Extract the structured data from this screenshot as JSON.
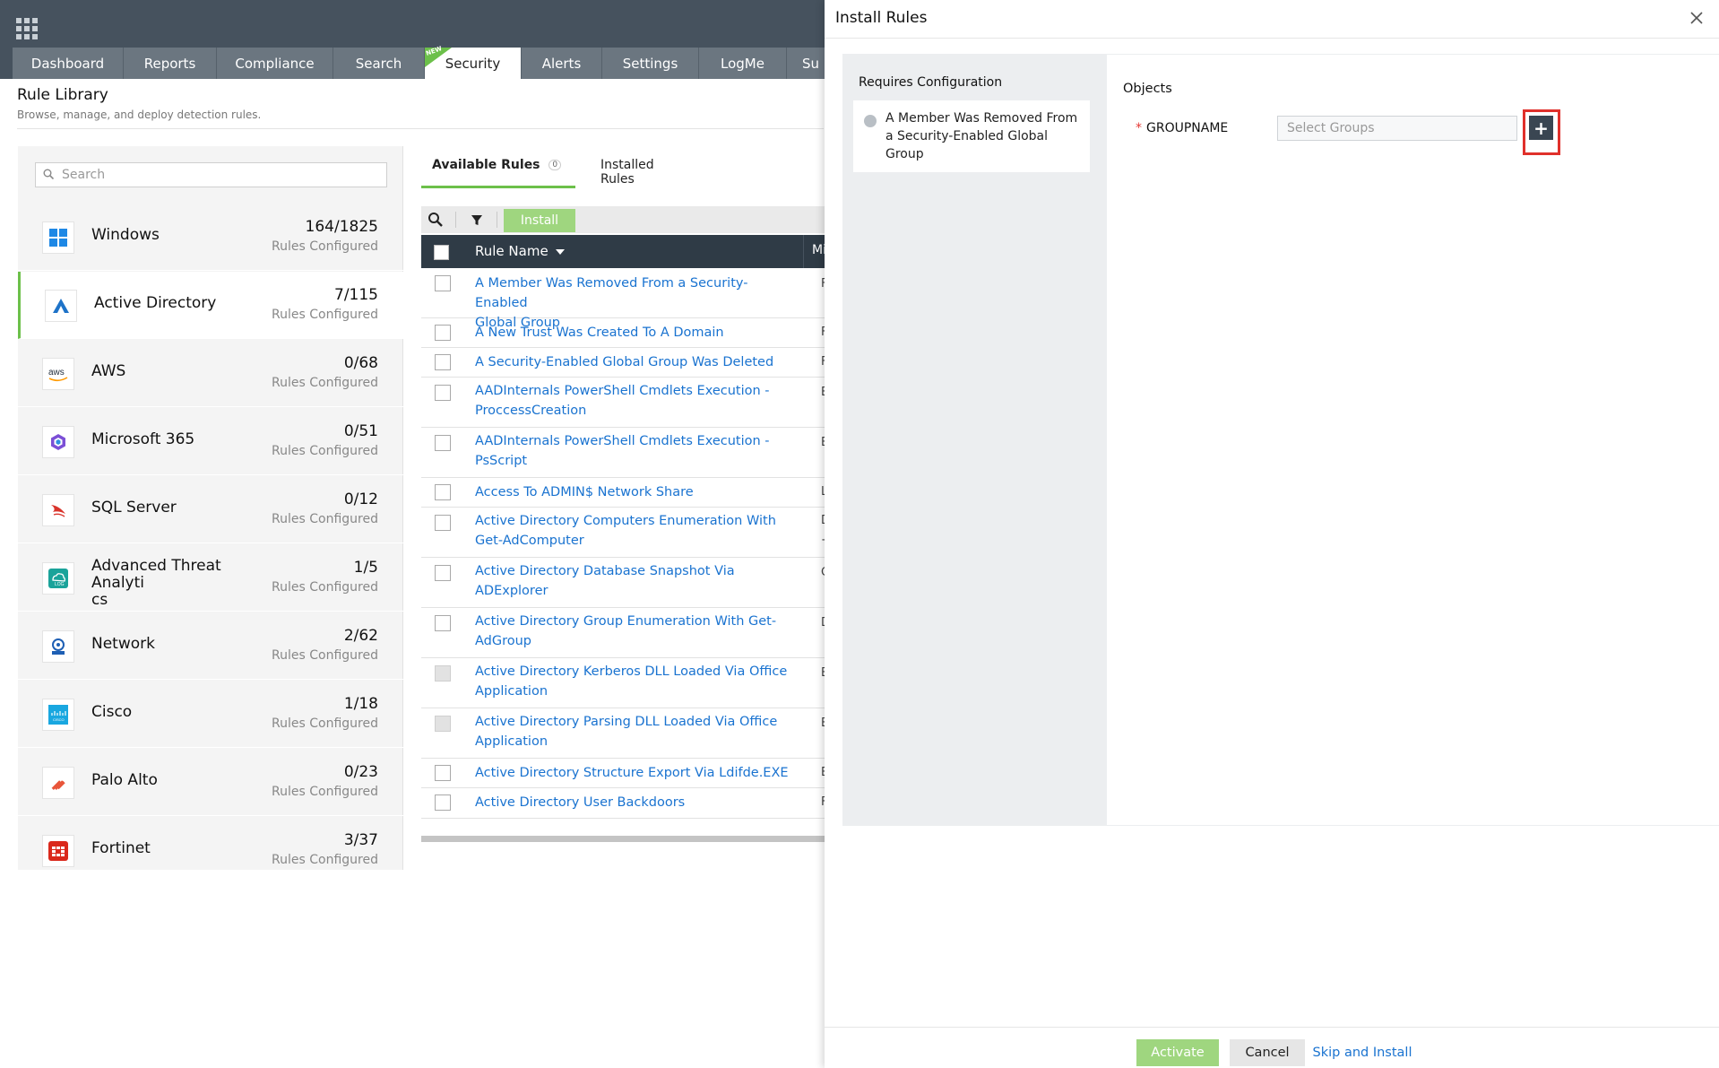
{
  "nav": {
    "tabs": [
      {
        "label": "Dashboard"
      },
      {
        "label": "Reports"
      },
      {
        "label": "Compliance"
      },
      {
        "label": "Search"
      },
      {
        "label": "Security",
        "badge": "NEW"
      },
      {
        "label": "Alerts"
      },
      {
        "label": "Settings"
      },
      {
        "label": "LogMe"
      },
      {
        "label": "Su"
      }
    ]
  },
  "page": {
    "title": "Rule Library",
    "subtitle": "Browse, manage, and deploy detection rules."
  },
  "categories": {
    "search_placeholder": "Search",
    "items": [
      {
        "name": "Windows",
        "count": "164/1825",
        "sub": "Rules Configured",
        "icon": "windows-icon"
      },
      {
        "name": "Active Directory",
        "count": "7/115",
        "sub": "Rules Configured",
        "icon": "active-directory-icon"
      },
      {
        "name": "AWS",
        "count": "0/68",
        "sub": "Rules Configured",
        "icon": "aws-icon"
      },
      {
        "name": "Microsoft 365",
        "count": "0/51",
        "sub": "Rules Configured",
        "icon": "microsoft-365-icon"
      },
      {
        "name": "SQL Server",
        "count": "0/12",
        "sub": "Rules Configured",
        "icon": "sql-server-icon"
      },
      {
        "name": "Advanced Threat Analytics",
        "name_line1": "Advanced Threat Analyti",
        "name_line2": "cs",
        "count": "1/5",
        "sub": "Rules Configured",
        "icon": "ata-icon"
      },
      {
        "name": "Network",
        "count": "2/62",
        "sub": "Rules Configured",
        "icon": "network-icon"
      },
      {
        "name": "Cisco",
        "count": "1/18",
        "sub": "Rules Configured",
        "icon": "cisco-icon"
      },
      {
        "name": "Palo Alto",
        "count": "0/23",
        "sub": "Rules Configured",
        "icon": "palo-alto-icon"
      },
      {
        "name": "Fortinet",
        "count": "3/37",
        "sub": "Rules Configured",
        "icon": "fortinet-icon"
      }
    ]
  },
  "rules": {
    "tabs": {
      "available": "Available Rules",
      "available_count": "0",
      "installed": "Installed Rules"
    },
    "install_label": "Install",
    "col_rule_name": "Rule Name",
    "col_second": "Mi",
    "rows": [
      {
        "name": "A Member Was Removed From a Security-Enabled Global Group",
        "l1": "A Member Was Removed From a Security-Enabled",
        "l2": "Global Group",
        "edge": "F"
      },
      {
        "name": "A New Trust Was Created To A Domain",
        "l1": "A New Trust Was Created To A Domain",
        "l2": "",
        "edge": "F"
      },
      {
        "name": "A Security-Enabled Global Group Was Deleted",
        "l1": "A Security-Enabled Global Group Was Deleted",
        "l2": "",
        "edge": "F"
      },
      {
        "name": "AADInternals PowerShell Cmdlets Execution - ProccessCreation",
        "l1": "AADInternals PowerShell Cmdlets Execution -",
        "l2": "ProccessCreation",
        "edge": "E"
      },
      {
        "name": "AADInternals PowerShell Cmdlets Execution - PsScript",
        "l1": "AADInternals PowerShell Cmdlets Execution -",
        "l2": "PsScript",
        "edge": "E"
      },
      {
        "name": "Access To ADMIN$ Network Share",
        "l1": "Access To ADMIN$ Network Share",
        "l2": "",
        "edge": "L"
      },
      {
        "name": "Active Directory Computers Enumeration With Get-AdComputer",
        "l1": "Active Directory Computers Enumeration With",
        "l2": "Get-AdComputer",
        "edge": "D",
        "edge2": "+"
      },
      {
        "name": "Active Directory Database Snapshot Via ADExplorer",
        "l1": "Active Directory Database Snapshot Via",
        "l2": "ADExplorer",
        "edge": "C"
      },
      {
        "name": "Active Directory Group Enumeration With Get-AdGroup",
        "l1": "Active Directory Group Enumeration With Get-",
        "l2": "AdGroup",
        "edge": "D"
      },
      {
        "name": "Active Directory Kerberos DLL Loaded Via Office Application",
        "l1": "Active Directory Kerberos DLL Loaded Via Office",
        "l2": "Application",
        "edge": "E",
        "disabled": true
      },
      {
        "name": "Active Directory Parsing DLL Loaded Via Office Application",
        "l1": "Active Directory Parsing DLL Loaded Via Office",
        "l2": "Application",
        "edge": "E",
        "disabled": true
      },
      {
        "name": "Active Directory Structure Export Via Ldifde.EXE",
        "l1": "Active Directory Structure Export Via Ldifde.EXE",
        "l2": "",
        "edge": "E"
      },
      {
        "name": "Active Directory User Backdoors",
        "l1": "Active Directory User Backdoors",
        "l2": "",
        "edge": "F"
      }
    ]
  },
  "dialog": {
    "title": "Install Rules",
    "requires_heading": "Requires Configuration",
    "requires_item_l1": "A Member Was Removed From",
    "requires_item_l2": "a Security-Enabled Global",
    "requires_item_l3": "Group",
    "objects_heading": "Objects",
    "field_label": "GROUPNAME",
    "field_required_mark": "*",
    "field_placeholder": "Select Groups",
    "add_label": "+",
    "activate_label": "Activate",
    "cancel_label": "Cancel",
    "skip_label": "Skip and Install"
  },
  "colors": {
    "accent_green": "#6cc04a",
    "button_green": "#9fd67f",
    "link_blue": "#1a73d0",
    "nav_dark": "#46525e",
    "highlight_red": "#e0302b"
  }
}
